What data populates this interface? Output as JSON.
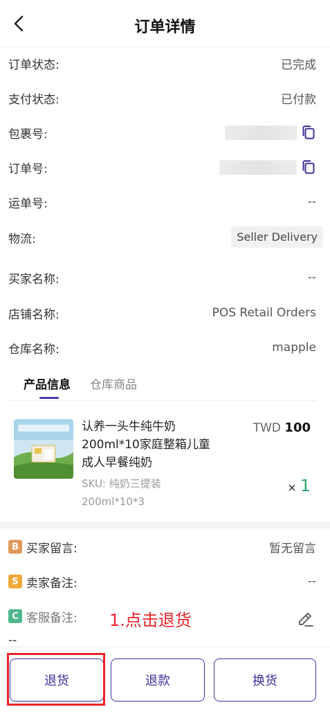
{
  "header": {
    "title": "订单详情"
  },
  "info_rows": [
    {
      "label": "订单状态:",
      "value": "已完成"
    },
    {
      "label": "支付状态:",
      "value": "已付款"
    },
    {
      "label": "包裹号:",
      "value": ""
    },
    {
      "label": "订单号:",
      "value": ""
    },
    {
      "label": "运单号:",
      "value": "--"
    },
    {
      "label": "物流:",
      "value": "Seller Delivery"
    },
    {
      "label": "买家名称:",
      "value": "--"
    },
    {
      "label": "店铺名称:",
      "value": "POS Retail Orders"
    },
    {
      "label": "仓库名称:",
      "value": "mapple"
    }
  ],
  "tabs": [
    {
      "label": "产品信息",
      "active": true
    },
    {
      "label": "仓库商品",
      "active": false
    }
  ],
  "product": {
    "name_line1": "认养一头牛纯牛奶",
    "name_line2": "200ml*10家庭整箱儿童",
    "name_line3": "成人早餐纯奶",
    "sku_line1": "SKU: 纯奶三提装",
    "sku_line2": "200ml*10*3",
    "currency": "TWD",
    "price": "100",
    "qty_prefix": "×",
    "qty": "1",
    "image_label": "3.5g/100mL 鲜活乳蛋白"
  },
  "notes": [
    {
      "badge": "B",
      "badge_color": "#e0995a",
      "label": "买家留言:",
      "value": "暂无留言"
    },
    {
      "badge": "S",
      "badge_color": "#f0a93a",
      "label": "卖家备注:",
      "value": "--"
    },
    {
      "badge": "C",
      "badge_color": "#4fb88a",
      "label": "客服备注:",
      "value": "--"
    }
  ],
  "annotation": "1.点击退货",
  "footer": {
    "return_label": "退货",
    "refund_label": "退款",
    "exchange_label": "换货"
  },
  "colors": {
    "accent": "#3c2f9a",
    "annotation_red": "#e8232b",
    "qty_green": "#2aa36b"
  }
}
